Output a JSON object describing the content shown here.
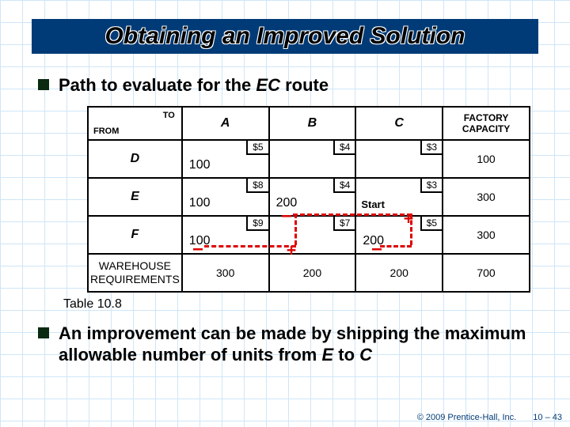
{
  "title": "Obtaining an Improved Solution",
  "bullet1_pre": "Path to evaluate for the ",
  "bullet1_em": "EC",
  "bullet1_post": " route",
  "table": {
    "to_label": "TO",
    "from_label": "FROM",
    "cols": {
      "A": "A",
      "B": "B",
      "C": "C",
      "cap": "FACTORY CAPACITY"
    },
    "rows": {
      "D": {
        "label": "D",
        "A": {
          "cost": "$5",
          "alloc": "100"
        },
        "B": {
          "cost": "$4"
        },
        "C": {
          "cost": "$3"
        },
        "cap": "100"
      },
      "E": {
        "label": "E",
        "A": {
          "cost": "$8",
          "alloc": "100"
        },
        "B": {
          "cost": "$4",
          "alloc": "200"
        },
        "C": {
          "cost": "$3",
          "start": "Start"
        },
        "cap": "300"
      },
      "F": {
        "label": "F",
        "A": {
          "cost": "$9",
          "alloc": "100"
        },
        "B": {
          "cost": "$7"
        },
        "C": {
          "cost": "$5",
          "alloc": "200"
        },
        "cap": "300"
      },
      "req": {
        "label": "WAREHOUSE REQUIREMENTS",
        "A": "300",
        "B": "200",
        "C": "200",
        "total": "700"
      }
    }
  },
  "caption": "Table 10.8",
  "bullet2_a": "An improvement can be made by shipping the maximum allowable number of units from ",
  "bullet2_em1": "E",
  "bullet2_mid": " to ",
  "bullet2_em2": "C",
  "copyright": "© 2009 Prentice-Hall, Inc.",
  "page": "10 – 43",
  "signs": {
    "plus": "+",
    "minus": "–"
  }
}
